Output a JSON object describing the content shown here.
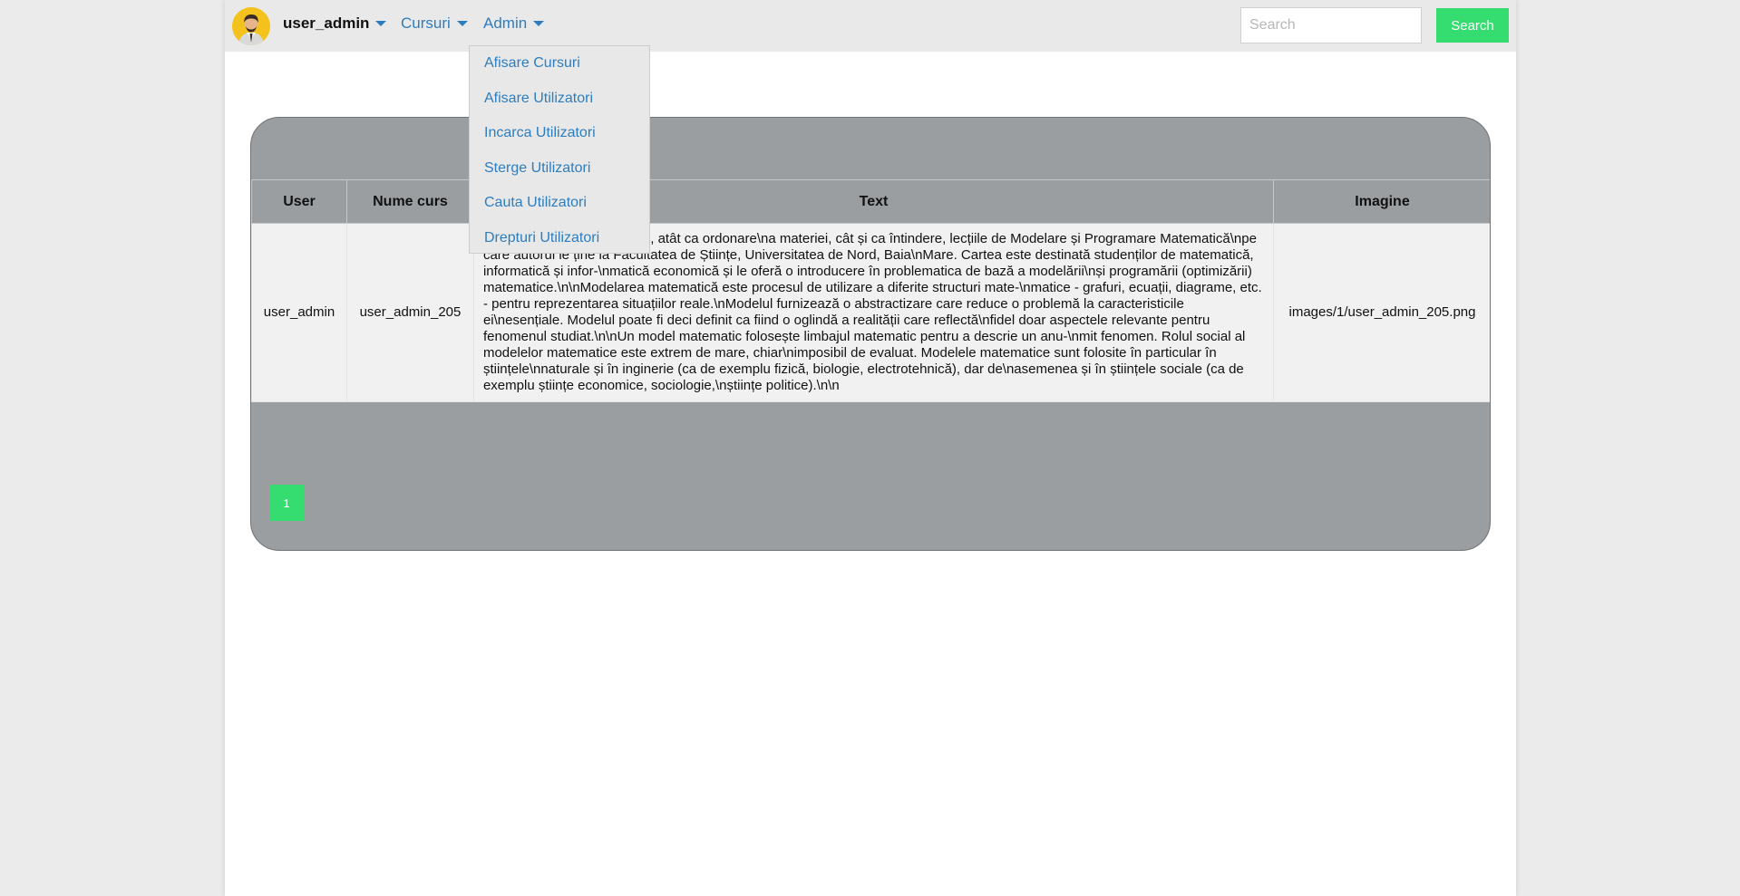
{
  "navbar": {
    "username": "user_admin",
    "cursuri_label": "Cursuri",
    "admin_label": "Admin",
    "search_placeholder": "Search",
    "search_button_label": "Search"
  },
  "admin_menu": {
    "items": [
      "Afisare Cursuri",
      "Afisare Utilizatori",
      "Incarca Utilizatori",
      "Sterge Utilizatori",
      "Cauta Utilizatori",
      "Drepturi Utilizatori"
    ]
  },
  "table": {
    "headers": [
      "User",
      "Nume curs",
      "Text",
      "Imagine"
    ],
    "rows": [
      {
        "user": "user_admin",
        "nume_curs": "user_admin_205",
        "text": "în mod cât se poate de fidel, atât ca ordonare\\na materiei, cât și ca întindere, lecțiile de Modelare și Programare Matematică\\npe care autorul le ține la Facultatea de Științe, Universitatea de Nord, Baia\\nMare. Cartea este destinată studenților de matematică, informatică și infor-\\nmatică economică și le oferă o introducere în problematica de bază a modelării\\nși programării (optimizării) matematice.\\n\\nModelarea matematică este procesul de utilizare a diferite structuri mate-\\nmatice - grafuri, ecuații, diagrame, etc. - pentru reprezentarea situațiilor reale.\\nModelul furnizează o abstractizare care reduce o problemă la caracteristicile ei\\nesențiale. Modelul poate fi deci definit ca fiind o oglindă a realității care reflectă\\nfidel doar aspectele relevante pentru fenomenul studiat.\\n\\nUn model matematic folosește limbajul matematic pentru a descrie un anu-\\nmit fenomen. Rolul social al modelelor matematice este extrem de mare, chiar\\nimposibil de evaluat. Modelele matematice sunt folosite în particular în științele\\nnaturale și în inginerie (ca de exemplu fizică, biologie, electrotehnică), dar de\\nasemenea și în științele sociale (ca de exemplu științe economice, sociologie,\\nștiințe politice).\\n\\n",
        "imagine": "images/1/user_admin_205.png"
      }
    ]
  },
  "pagination": {
    "current_page": "1"
  },
  "colors": {
    "accent_green": "#35dc6f",
    "link_blue": "#2d7dbf",
    "panel_gray": "#9a9ea1",
    "avatar_yellow": "#f3c21d"
  },
  "icons": {
    "avatar": "user-avatar-icon",
    "dropdown": "caret-down-icon"
  }
}
